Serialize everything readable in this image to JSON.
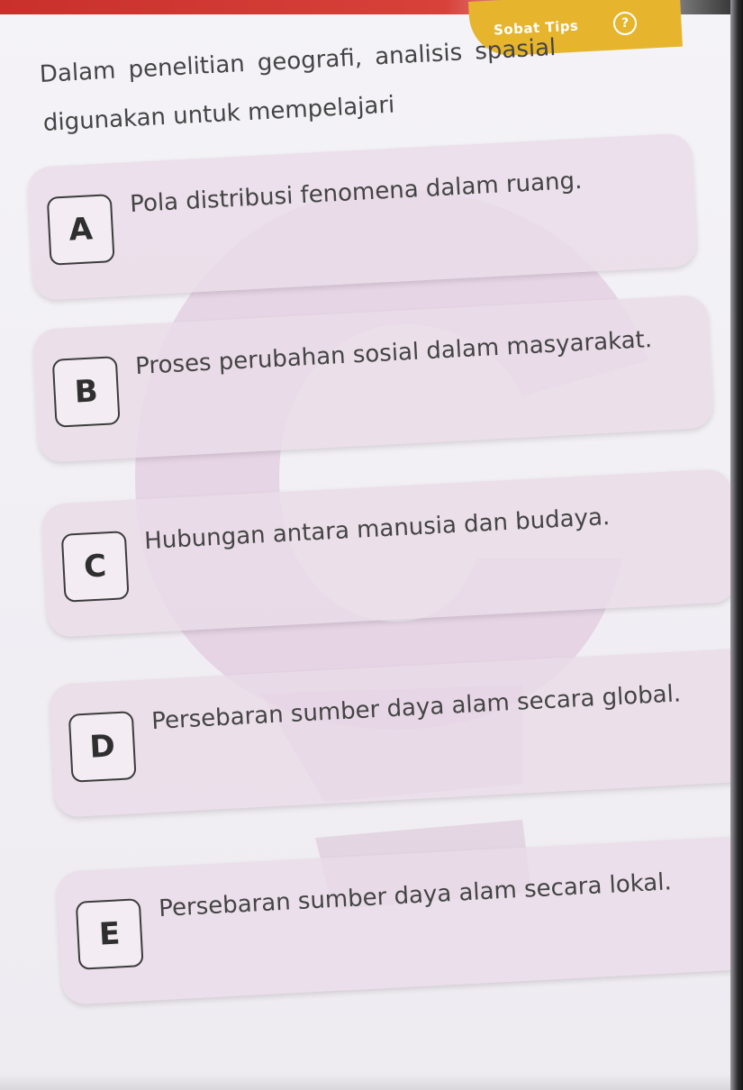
{
  "header": {
    "tips_label": "Sobat Tips",
    "tips_icon": "question-circle-icon",
    "accent_color": "#e6b52d"
  },
  "question": {
    "line1": "Dalam penelitian geografi, analisis spasial",
    "line2": "digunakan untuk mempelajari"
  },
  "options": [
    {
      "letter": "A",
      "text": "Pola distribusi fenomena dalam ruang."
    },
    {
      "letter": "B",
      "text": "Proses perubahan sosial dalam masyarakat."
    },
    {
      "letter": "C",
      "text": "Hubungan antara manusia dan budaya."
    },
    {
      "letter": "D",
      "text": "Persebaran sumber daya alam secara global."
    },
    {
      "letter": "E",
      "text": "Persebaran sumber daya alam secara lokal."
    }
  ],
  "colors": {
    "option_background": "#e9dce8",
    "watermark": "#d9b8d3",
    "text": "#444444"
  }
}
